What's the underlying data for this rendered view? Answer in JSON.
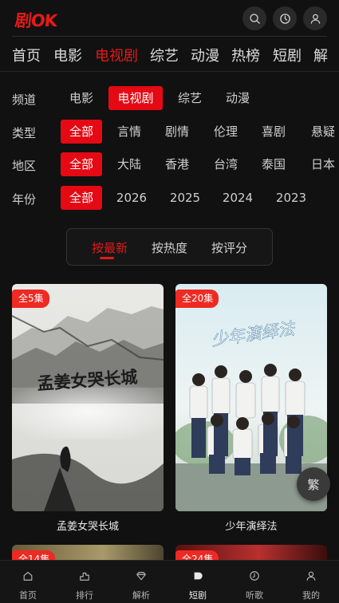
{
  "header": {
    "logo": "剧OK",
    "search_icon": "search-icon",
    "history_icon": "clock-icon",
    "user_icon": "user-icon"
  },
  "nav": {
    "tabs": [
      "首页",
      "电影",
      "电视剧",
      "综艺",
      "动漫",
      "热榜",
      "短剧",
      "解"
    ],
    "active": "电视剧"
  },
  "filters": {
    "channel": {
      "label": "频道",
      "options": [
        "电影",
        "电视剧",
        "综艺",
        "动漫"
      ],
      "selected": "电视剧"
    },
    "type": {
      "label": "类型",
      "options": [
        "全部",
        "言情",
        "剧情",
        "伦理",
        "喜剧",
        "悬疑"
      ],
      "selected": "全部"
    },
    "region": {
      "label": "地区",
      "options": [
        "全部",
        "大陆",
        "香港",
        "台湾",
        "泰国",
        "日本"
      ],
      "selected": "全部"
    },
    "year": {
      "label": "年份",
      "options": [
        "全部",
        "2026",
        "2025",
        "2024",
        "2023"
      ],
      "selected": "全部"
    }
  },
  "sort": {
    "options": [
      "按最新",
      "按热度",
      "按评分"
    ],
    "selected": "按最新"
  },
  "cards": [
    {
      "title": "孟姜女哭长城",
      "badge": "全5集",
      "poster_text": "孟姜女哭长城"
    },
    {
      "title": "少年演绎法",
      "badge": "全20集",
      "poster_text": "少年演绎法"
    },
    {
      "title": "",
      "badge": "全14集"
    },
    {
      "title": "",
      "badge": "全24集"
    }
  ],
  "fab": {
    "label": "繁"
  },
  "bottom_nav": {
    "items": [
      {
        "label": "首页",
        "icon": "home-icon"
      },
      {
        "label": "排行",
        "icon": "ranking-icon"
      },
      {
        "label": "解析",
        "icon": "diamond-icon"
      },
      {
        "label": "短剧",
        "icon": "play-icon"
      },
      {
        "label": "听歌",
        "icon": "music-icon"
      },
      {
        "label": "我的",
        "icon": "user-icon"
      }
    ],
    "active": "短剧"
  },
  "colors": {
    "accent": "#e31a1a",
    "background": "#111111",
    "badge": "#ee2a22"
  }
}
